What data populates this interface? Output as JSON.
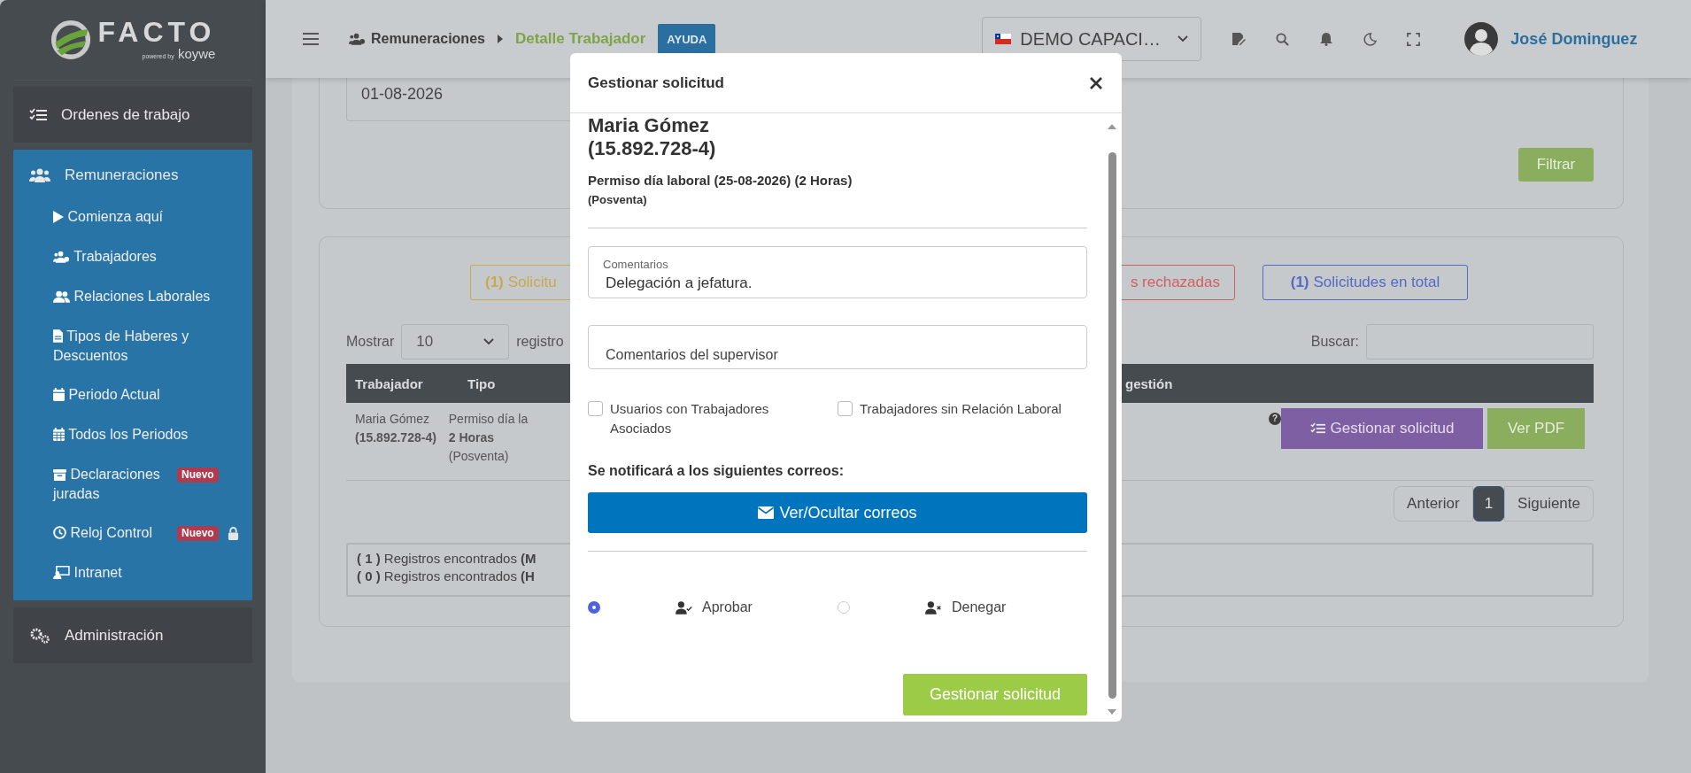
{
  "sidebar": {
    "logo": {
      "name": "FACTO",
      "powered": "powered",
      "by": "by",
      "brand": "koywe"
    },
    "items": [
      {
        "label": "Ordenes de trabajo",
        "expanded": false
      },
      {
        "label": "Remuneraciones",
        "expanded": true,
        "children": [
          {
            "label": "Comienza aquí"
          },
          {
            "label": "Trabajadores"
          },
          {
            "label": "Relaciones Laborales"
          },
          {
            "label": "Tipos de Haberes y Descuentos"
          },
          {
            "label": "Periodo Actual"
          },
          {
            "label": "Todos los Periodos"
          },
          {
            "label": "Declaraciones juradas",
            "badge": "Nuevo"
          },
          {
            "label": "Reloj Control",
            "badge": "Nuevo",
            "locked": true
          },
          {
            "label": "Intranet"
          }
        ]
      },
      {
        "label": "Administración",
        "expanded": false
      }
    ]
  },
  "topbar": {
    "breadcrumbs": [
      {
        "label": "Remuneraciones",
        "selected": false
      },
      {
        "label": "Detalle Trabajador",
        "selected": true
      }
    ],
    "help": "AYUDA",
    "company": "DEMO CAPACI…",
    "user": "José Dominguez"
  },
  "filters": {
    "date_field": {
      "value": "01-08-2026"
    },
    "filter_button": "Filtrar"
  },
  "summary_badges": [
    {
      "count": "(1)",
      "label": "Solicitu",
      "color": "#c8a850"
    },
    {
      "label": "s rechazadas",
      "color": "#d2605e"
    },
    {
      "count": "(1)",
      "label": "Solicitudes en total",
      "color": "#5468c4"
    }
  ],
  "table_controls": {
    "show_label": "Mostrar",
    "page_size": "10",
    "records_label": "registro",
    "search_label": "Buscar:"
  },
  "table": {
    "columns": [
      "Trabajador",
      "Tipo",
      "gestión"
    ],
    "rows": [
      {
        "worker_name": "Maria Gómez",
        "worker_id": "(15.892.728-4)",
        "type": "Permiso día la",
        "hours": "2 Horas",
        "area": "(Posventa)",
        "help": "?",
        "actions": [
          "Gestionar solicitud",
          "Ver PDF"
        ]
      }
    ]
  },
  "pagination": {
    "previous": "Anterior",
    "pages": [
      {
        "label": "1",
        "selected": true
      }
    ],
    "next": "Siguiente"
  },
  "records": [
    "**( 1 )** Registros encontrados **(M**",
    "**( 0 )** Registros encontrados **(H**"
  ],
  "modal": {
    "title": "Gestionar solicitud",
    "worker_name": "Maria Gómez",
    "worker_id": "(15.892.728-4)",
    "request": "Permiso día laboral (25-08-2026) (2 Horas)",
    "area": "(Posventa)",
    "comments": {
      "label": "Comentarios",
      "value": "Delegación a jefatura."
    },
    "supervisor_comments": {
      "placeholder": "Comentarios del supervisor"
    },
    "options": [
      {
        "label": "Usuarios con Trabajadores Asociados",
        "checked": false
      },
      {
        "label": "Trabajadores sin Relación Laboral",
        "checked": false
      }
    ],
    "notify_label": "Se notificará a los siguientes correos:",
    "toggle_emails": "Ver/Ocultar correos",
    "decisions": [
      {
        "label": "Aprobar",
        "kind": "approve",
        "selected": true
      },
      {
        "label": "Denegar",
        "kind": "deny",
        "selected": false
      }
    ],
    "submit": "Gestionar solicitud"
  }
}
